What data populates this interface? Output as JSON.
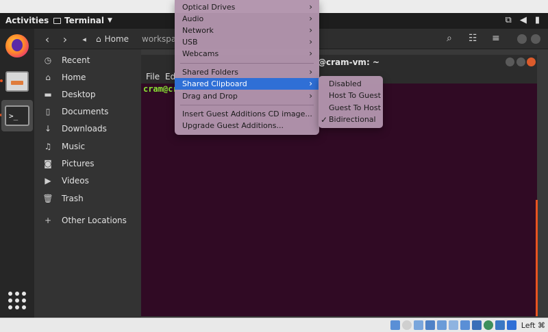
{
  "top_bar": {
    "activities": "Activities",
    "app_name": "Terminal",
    "tray_icons": [
      "network-icon",
      "volume-icon",
      "battery-icon"
    ]
  },
  "dock": {
    "items": [
      "firefox-icon",
      "files-icon",
      "terminal-icon"
    ],
    "apps_grid": "show-applications-icon"
  },
  "files": {
    "path_home": "Home",
    "path_work": "workspa",
    "sidebar": [
      {
        "label": "Recent",
        "icon": "clock-icon"
      },
      {
        "label": "Home",
        "icon": "home-icon"
      },
      {
        "label": "Desktop",
        "icon": "folder-icon"
      },
      {
        "label": "Documents",
        "icon": "document-icon"
      },
      {
        "label": "Downloads",
        "icon": "download-icon"
      },
      {
        "label": "Music",
        "icon": "music-icon"
      },
      {
        "label": "Pictures",
        "icon": "camera-icon"
      },
      {
        "label": "Videos",
        "icon": "video-icon"
      },
      {
        "label": "Trash",
        "icon": "trash-icon"
      },
      {
        "label": "Other Locations",
        "icon": "plus-icon"
      }
    ]
  },
  "terminal": {
    "title_suffix": "@cram-vm: ~",
    "menu_file": "File",
    "menu_edit": "Ed",
    "prompt": "cram@cra"
  },
  "menu": {
    "items": [
      {
        "label": "Optical Drives",
        "submenu": true
      },
      {
        "label": "Audio",
        "submenu": true
      },
      {
        "label": "Network",
        "submenu": true
      },
      {
        "label": "USB",
        "submenu": true
      },
      {
        "label": "Webcams",
        "submenu": true
      },
      {
        "label": "Shared Folders",
        "submenu": true
      },
      {
        "label": "Shared Clipboard",
        "submenu": true,
        "highlighted": true
      },
      {
        "label": "Drag and Drop",
        "submenu": true
      },
      {
        "label": "Insert Guest Additions CD image...",
        "submenu": false
      },
      {
        "label": "Upgrade Guest Additions...",
        "submenu": false
      }
    ],
    "submenu_items": [
      {
        "label": "Disabled",
        "checked": false
      },
      {
        "label": "Host To Guest",
        "checked": false
      },
      {
        "label": "Guest To Host",
        "checked": false
      },
      {
        "label": "Bidirectional",
        "checked": true
      }
    ],
    "highlight_color": "#2f6fd6"
  },
  "statusbar": {
    "host_key": "Left ⌘"
  }
}
